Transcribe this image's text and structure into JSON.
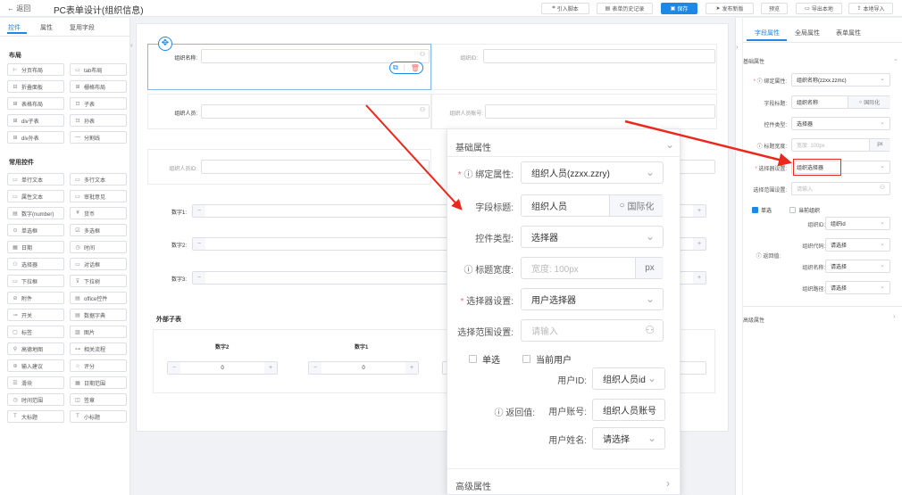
{
  "topbar": {
    "back": "← 返回",
    "title": "PC表单设计(组织信息)",
    "buttons": [
      "引入脚本",
      "表单历史记录",
      "保存",
      "发布新版",
      "预览",
      "导出本地",
      "本地导入"
    ]
  },
  "left": {
    "tabs": [
      "控件",
      "属性",
      "复用字段"
    ],
    "layout_title": "布局",
    "layout_items": [
      "分页布局",
      "tab布局",
      "折叠面板",
      "栅格布局",
      "表格布局",
      "子表",
      "div子表",
      "孙表",
      "div孙表",
      "分割线"
    ],
    "common_title": "常用控件",
    "common_items": [
      "单行文本",
      "多行文本",
      "属性文本",
      "审批意见",
      "数字(number)",
      "货币",
      "单选框",
      "多选框",
      "日期",
      "时间",
      "选择器",
      "对话框",
      "下拉框",
      "下拉树",
      "附件",
      "office控件",
      "开关",
      "数据字典",
      "标签",
      "图片",
      "高德地图",
      "相关流程",
      "输入建议",
      "评分",
      "滑块",
      "日期范围",
      "时间范围",
      "签章",
      "大标题",
      "小标题"
    ]
  },
  "canvas": {
    "f1_label": "组织名称:",
    "f1_right_label": "组织ID:",
    "f2_label": "组织人员:",
    "f2_right_label": "组织人员账号:",
    "f3_label": "组织人员ID:",
    "numbers": [
      "数字1:",
      "数字2:",
      "数字3:"
    ],
    "subtable_title": "外部子表",
    "sub_cols": [
      "数字2",
      "数字1"
    ],
    "sub_value": "0",
    "minus": "−",
    "plus": "+"
  },
  "right": {
    "tabs": [
      "字段属性",
      "全局属性",
      "表单属性"
    ],
    "basic_title": "基础属性",
    "bind_label": "绑定属性:",
    "bind_value": "组织名称(zzxx.zzmc)",
    "title_label": "字段标题:",
    "title_value": "组织名称",
    "i18n": "国际化",
    "type_label": "控件类型:",
    "type_value": "选择器",
    "width_label": "标题宽度:",
    "width_placeholder": "宽度: 100px",
    "unit": "px",
    "selector_label": "选择器设置:",
    "selector_value": "组织选择器",
    "range_label": "选择范围设置:",
    "range_placeholder": "请输入",
    "single": "单选",
    "current": "当前组织",
    "return_label": "返回值:",
    "rows": [
      {
        "label": "组织ID:",
        "value": "组织id"
      },
      {
        "label": "组织代码:",
        "value": "请选择"
      },
      {
        "label": "组织名称:",
        "value": "请选择"
      },
      {
        "label": "组织路径:",
        "value": "请选择"
      }
    ],
    "advanced_title": "高级属性"
  },
  "zoom": {
    "basic_title": "基础属性",
    "bind_label": "绑定属性:",
    "bind_value": "组织人员(zzxx.zzry)",
    "title_label": "字段标题:",
    "title_value": "组织人员",
    "i18n": "国际化",
    "type_label": "控件类型:",
    "type_value": "选择器",
    "width_label": "标题宽度:",
    "width_placeholder": "宽度: 100px",
    "unit": "px",
    "selector_label": "选择器设置:",
    "selector_value": "用户选择器",
    "range_label": "选择范围设置:",
    "range_placeholder": "请输入",
    "single": "单选",
    "current": "当前用户",
    "return_label": "返回值:",
    "rows": [
      {
        "label": "用户ID:",
        "value": "组织人员id"
      },
      {
        "label": "用户账号:",
        "value": "组织人员账号"
      },
      {
        "label": "用户姓名:",
        "value": "请选择"
      }
    ],
    "advanced_title": "高级属性"
  },
  "colors": {
    "accent": "#1e88e5",
    "arrow": "#e8291c",
    "required": "#f56c6c"
  }
}
